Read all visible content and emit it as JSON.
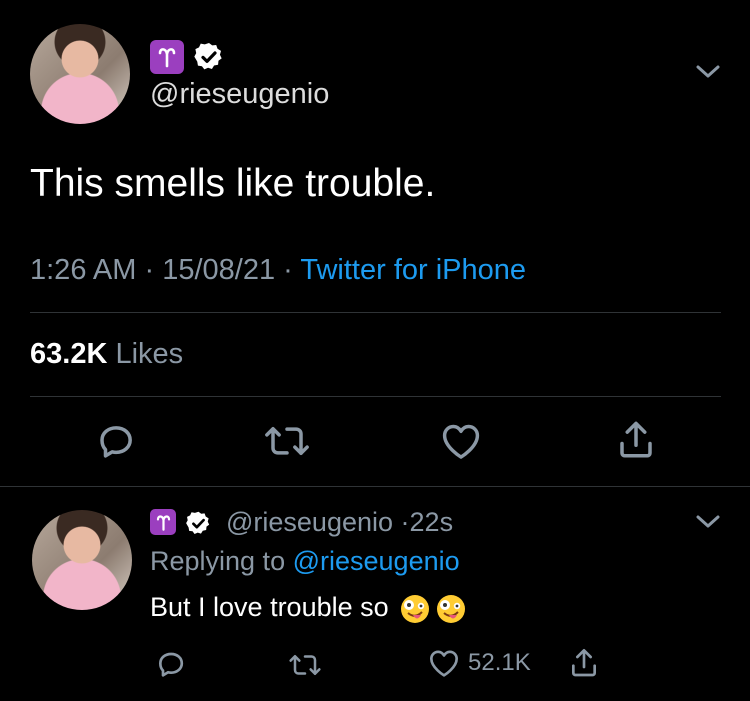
{
  "main_tweet": {
    "handle": "@rieseugenio",
    "text": "This smells like trouble.",
    "time": "1:26 AM",
    "dot1": "·",
    "date": "15/08/21",
    "dot2": "·",
    "source": "Twitter for iPhone",
    "likes_count": "63.2K",
    "likes_label": "Likes",
    "aries_glyph": "♈",
    "verified": true
  },
  "reply_tweet": {
    "handle": "@rieseugenio",
    "time_sep": "·",
    "age": "22s",
    "replying_prefix": "Replying to",
    "replying_handle": "@rieseugenio",
    "text": "But I love trouble so",
    "emoji": "🤪🤪",
    "like_count": "52.1K",
    "aries_glyph": "♈"
  },
  "colors": {
    "background": "#000000",
    "accent_blue": "#1d9bf0",
    "muted_gray": "#8b98a5",
    "aries_purple": "#9b3fbf",
    "divider": "#2f3336"
  },
  "icons": [
    "chevron-down-icon",
    "reply-icon",
    "retweet-icon",
    "like-icon",
    "share-icon",
    "verified-icon",
    "aries-icon"
  ]
}
